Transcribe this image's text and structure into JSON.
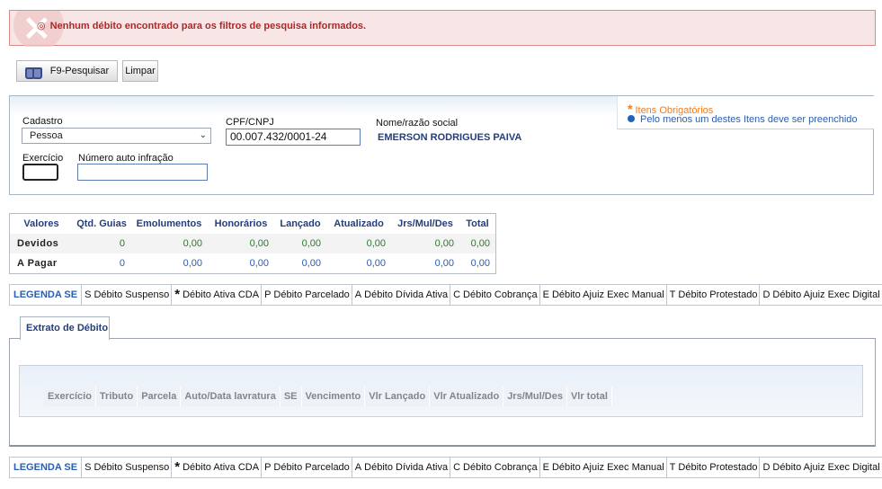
{
  "alert": {
    "bullet": "◎",
    "message": "Nenhum débito encontrado para os filtros de pesquisa informados."
  },
  "toolbar": {
    "search_label": "F9-Pesquisar",
    "clear_label": "Limpar"
  },
  "form": {
    "cadastro_label": "Cadastro",
    "cadastro_value": "Pessoa",
    "cpf_label": "CPF/CNPJ",
    "cpf_value": "00.007.432/0001-24",
    "nome_label": "Nome/razão social",
    "nome_value": "EMERSON RODRIGUES PAIVA",
    "exercicio_label": "Exercício",
    "exercicio_value": "",
    "auto_label": "Número auto infração",
    "auto_value": ""
  },
  "requirements": {
    "star": "*",
    "required_text": "Itens Obrigatórios",
    "atleast_text": "Pelo menos um destes Itens deve ser preenchido"
  },
  "values_table": {
    "headers": [
      "Valores",
      "Qtd. Guias",
      "Emolumentos",
      "Honorários",
      "Lançado",
      "Atualizado",
      "Jrs/Mul/Des",
      "Total"
    ],
    "rows": [
      {
        "label": "Devidos",
        "cells": [
          "0",
          "0,00",
          "0,00",
          "0,00",
          "0,00",
          "0,00",
          "0,00"
        ]
      },
      {
        "label": "A Pagar",
        "cells": [
          "0",
          "0,00",
          "0,00",
          "0,00",
          "0,00",
          "0,00",
          "0,00"
        ]
      }
    ]
  },
  "legend": {
    "title": "LEGENDA SE",
    "items": [
      {
        "code": "S",
        "label": "Débito Suspenso"
      },
      {
        "code": "*",
        "label": "Débito Ativa CDA"
      },
      {
        "code": "P",
        "label": "Débito Parcelado"
      },
      {
        "code": "A",
        "label": "Débito Dívida Ativa"
      },
      {
        "code": "C",
        "label": "Débito Cobrança"
      },
      {
        "code": "E",
        "label": "Débito Ajuiz Exec Manual"
      },
      {
        "code": "T",
        "label": "Débito Protestado"
      },
      {
        "code": "D",
        "label": "Débito Ajuiz Exec Digital"
      }
    ]
  },
  "extrato": {
    "tab_label": "Extrato de Débito",
    "columns": [
      "Exercício",
      "Tributo",
      "Parcela",
      "Auto/Data lavratura",
      "SE",
      "Vencimento",
      "Vlr Lançado",
      "Vlr Atualizado",
      "Jrs/Mul/Des",
      "Vlr total"
    ]
  }
}
